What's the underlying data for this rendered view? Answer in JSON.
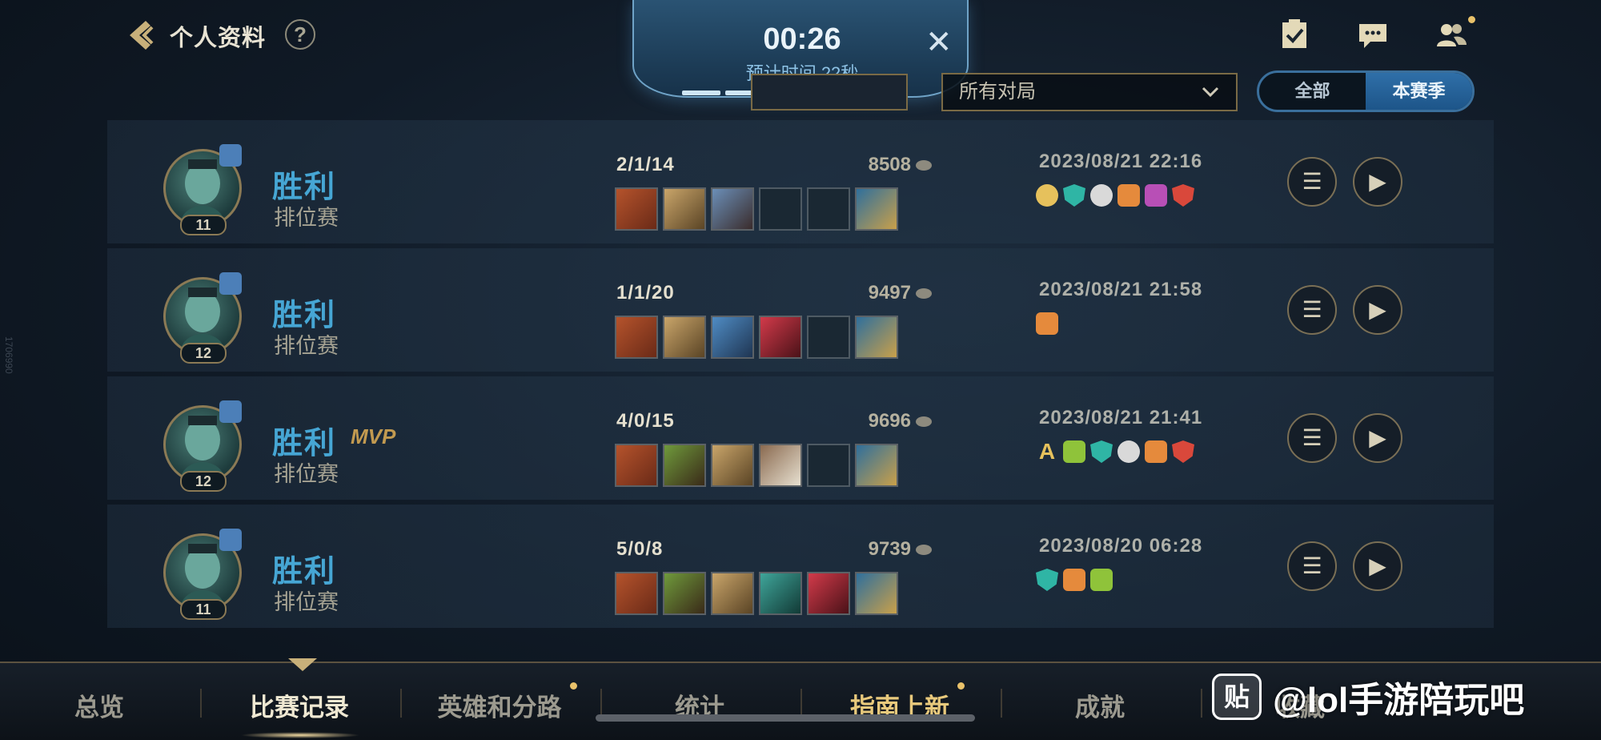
{
  "header": {
    "title": "个人资料",
    "help_icon": "?",
    "timer": "00:26",
    "eta": "预计时间 22秒",
    "close_icon": "✕",
    "filter_value": "所有对局",
    "segments": [
      "全部",
      "本赛季"
    ],
    "active_segment": "本赛季",
    "icons": [
      "task-checklist-icon",
      "chat-icon",
      "friends-icon"
    ]
  },
  "side_id": "1706990",
  "matches": [
    {
      "result": "胜利",
      "mvp": "",
      "mode": "排位赛",
      "level": "11",
      "kda": "2/1/14",
      "gold": "8508",
      "date": "2023/08/21 22:16",
      "items": [
        "orange",
        "gold",
        "blue",
        "empty",
        "empty",
        "boot"
      ],
      "tags": [
        "#e6c15c",
        "#2fb5a5",
        "#d9d9d9",
        "#e58a3c",
        "#b84fb6",
        "#d9483b"
      ]
    },
    {
      "result": "胜利",
      "mvp": "",
      "mode": "排位赛",
      "level": "12",
      "kda": "1/1/20",
      "gold": "9497",
      "date": "2023/08/21 21:58",
      "items": [
        "orange",
        "gold",
        "blue",
        "red",
        "empty",
        "boot"
      ],
      "tags": [
        "#e58a3c"
      ]
    },
    {
      "result": "胜利",
      "mvp": "MVP",
      "mode": "排位赛",
      "level": "12",
      "kda": "4/0/15",
      "gold": "9696",
      "date": "2023/08/21 21:41",
      "items": [
        "orange",
        "green",
        "gold",
        "brown",
        "empty",
        "boot"
      ],
      "tags": [
        "A",
        "#8fc33a",
        "#2fb5a5",
        "#d9d9d9",
        "#e58a3c",
        "#d9483b"
      ]
    },
    {
      "result": "胜利",
      "mvp": "",
      "mode": "排位赛",
      "level": "11",
      "kda": "5/0/8",
      "gold": "9739",
      "date": "2023/08/20 06:28",
      "items": [
        "orange",
        "green",
        "gold",
        "teal",
        "red",
        "boot"
      ],
      "tags": [
        "#2fb5a5",
        "#e58a3c",
        "#8fc33a"
      ]
    }
  ],
  "tabs": [
    "总览",
    "比赛记录",
    "英雄和分路",
    "统计",
    "指南上新",
    "成就",
    "收藏"
  ],
  "active_tab": "比赛记录",
  "watermark": {
    "logo": "贴",
    "text": "@lol手游陪玩吧"
  },
  "colors": {
    "win": "#46a6d4",
    "accent_gold": "#c29a50",
    "segment_active": "#2f6fa8"
  }
}
